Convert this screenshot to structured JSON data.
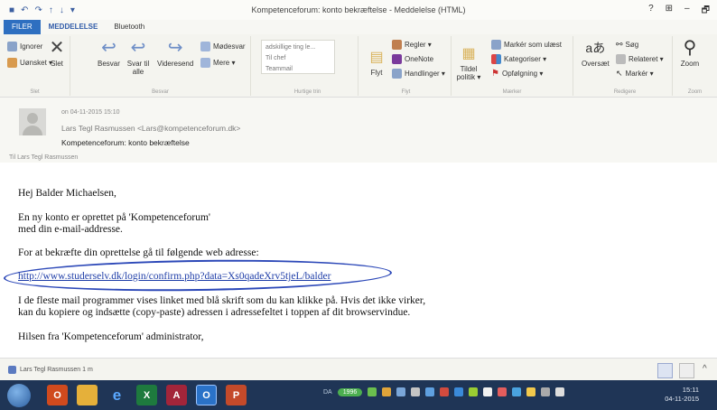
{
  "window": {
    "title": "Kompetenceforum: konto bekræftelse - Meddelelse (HTML)",
    "controls": [
      "?",
      "⊞",
      "–",
      "🗗"
    ]
  },
  "tabs": [
    "FILER",
    "MEDDELELSE",
    "Bluetooth"
  ],
  "ribbon": {
    "delete_group": {
      "ignore": "Ignorer",
      "junk": "Uønsket ▾",
      "delete": "Slet",
      "label": "Slet"
    },
    "respond_group": {
      "reply": "Besvar",
      "reply_all": "Svar til alle",
      "forward": "Videresend",
      "meeting": "Mødesvar",
      "more": "Mere ▾",
      "label": "Besvar"
    },
    "quick_group": {
      "items": [
        "adskillige ting le...",
        "Til chef",
        "Teammail"
      ],
      "label": "Hurtige trin"
    },
    "move_group": {
      "move": "Flyt",
      "rules": "Regler ▾",
      "onenote": "OneNote",
      "actions": "Handlinger ▾",
      "label": "Flyt"
    },
    "tags_group": {
      "assign": "Tildel politik ▾",
      "unread": "Markér som ulæst",
      "categorize": "Kategoriser ▾",
      "followup": "Opfølgning ▾",
      "label": "Mærker"
    },
    "edit_group": {
      "translate": "Oversæt",
      "search": "Søg",
      "related": "Relateret ▾",
      "select": "Markér ▾",
      "label": "Redigere"
    },
    "zoom_group": {
      "zoom": "Zoom",
      "label": "Zoom"
    }
  },
  "header": {
    "date": "on 04-11-2015 15:10",
    "from": "Lars Tegl Rasmussen <Lars@kompetenceforum.dk>",
    "subject": "Kompetenceforum: konto bekræftelse",
    "to": "Til   Lars Tegl Rasmussen"
  },
  "body": {
    "greeting": "Hej Balder Michaelsen,",
    "line1": "En ny konto er oprettet på 'Kompetenceforum'",
    "line2": "med din e-mail-addresse.",
    "line3": "For at bekræfte din oprettelse gå til følgende web adresse:",
    "link": "http://www.studerselv.dk/login/confirm.php?data=Xs0qadeXrv5tjeL/balder",
    "line4": "I de fleste mail programmer vises linket med blå skrift som du kan klikke på. Hvis det ikke virker,",
    "line5": "kan du kopiere og indsætte (copy-paste) adressen i adressefeltet i toppen af dit browservindue.",
    "closing": "Hilsen fra 'Kompetenceforum' administrator,"
  },
  "footer": {
    "person": "Lars Tegl Rasmussen  1 m"
  },
  "taskbar": {
    "apps": [
      "",
      "O",
      "",
      "e",
      "X",
      "A",
      "O",
      "P"
    ],
    "tray_da": "DA",
    "tray_pill": "1996",
    "time": "15:11",
    "date": "04-11-2015"
  },
  "colors": {
    "accent": "#2e6fc0",
    "link": "#1f3ea8",
    "taskbar": "#1f3556"
  }
}
